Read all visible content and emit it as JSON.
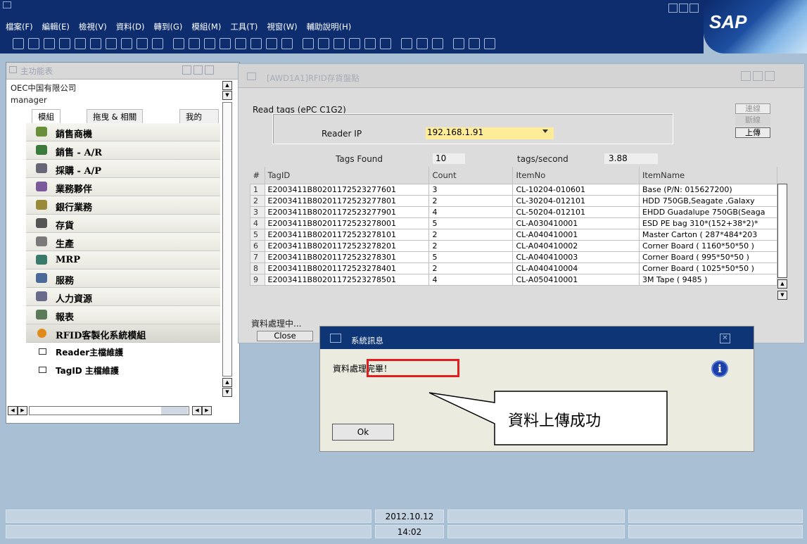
{
  "menu": [
    "檔案(F)",
    "編輯(E)",
    "檢視(V)",
    "資料(D)",
    "轉到(G)",
    "模組(M)",
    "工具(T)",
    "視窗(W)",
    "輔助說明(H)"
  ],
  "logo": "SAP",
  "main_menu": {
    "title": "主功能表",
    "company": "OEC中国有限公司",
    "user": "manager",
    "tabs": [
      "模組",
      "拖曳 & 相關",
      "我的"
    ],
    "modules": [
      {
        "label": "銷售商機",
        "icon": "opportunity-icon",
        "color": "#6a8f3a"
      },
      {
        "label": "銷售 - A/R",
        "icon": "sales-icon",
        "color": "#3c7a3c"
      },
      {
        "label": "採購 - A/P",
        "icon": "purchasing-icon",
        "color": "#667"
      },
      {
        "label": "業務夥伴",
        "icon": "partners-icon",
        "color": "#7a5a9a"
      },
      {
        "label": "銀行業務",
        "icon": "banking-icon",
        "color": "#998a3a"
      },
      {
        "label": "存貨",
        "icon": "inventory-icon",
        "color": "#555"
      },
      {
        "label": "生產",
        "icon": "production-icon",
        "color": "#7a7a7a"
      },
      {
        "label": "MRP",
        "icon": "mrp-icon",
        "color": "#3a7a6a"
      },
      {
        "label": "服務",
        "icon": "service-icon",
        "color": "#4a6a9a"
      },
      {
        "label": "人力資源",
        "icon": "hr-icon",
        "color": "#6a6a8a"
      },
      {
        "label": "報表",
        "icon": "reports-icon",
        "color": "#5a7a5a"
      },
      {
        "label": "RFID客製化系統模組",
        "icon": "rfid-icon",
        "color": "#e08a1a"
      }
    ],
    "submodules": [
      {
        "label": "Reader主檔維護"
      },
      {
        "label": "TagID 主檔維護"
      }
    ]
  },
  "rfid_window": {
    "title": "[AWD1A1]RFID存貨盤點",
    "read_tags": "Read tags (ePC C1G2)",
    "reader_ip_label": "Reader IP",
    "reader_ip": "192.168.1.91",
    "connect": "連線",
    "disconnect": "斷線",
    "upload": "上傳",
    "tags_found_label": "Tags Found",
    "tags_found": "10",
    "tags_per_second_label": "tags/second",
    "tags_per_second": "3.88",
    "columns": [
      "#",
      "TagID",
      "Count",
      "ItemNo",
      "ItemName"
    ],
    "rows": [
      [
        "1",
        "E2003411B80201172523277601",
        "3",
        "CL-10204-010601",
        "Base (P/N: 015627200)"
      ],
      [
        "2",
        "E2003411B80201172523277801",
        "2",
        "CL-30204-012101",
        "HDD 750GB,Seagate ,Galaxy"
      ],
      [
        "3",
        "E2003411B80201172523277901",
        "4",
        "CL-50204-012101",
        "EHDD Guadalupe 750GB(Seaga"
      ],
      [
        "4",
        "E2003411B80201172523278001",
        "5",
        "CL-A030410001",
        "ESD PE bag 310*(152+38*2)*"
      ],
      [
        "5",
        "E2003411B80201172523278101",
        "2",
        "CL-A040410001",
        "Master Carton ( 287*484*203"
      ],
      [
        "6",
        "E2003411B80201172523278201",
        "2",
        "CL-A040410002",
        "Corner Board ( 1160*50*50 )"
      ],
      [
        "7",
        "E2003411B80201172523278301",
        "5",
        "CL-A040410003",
        "Corner Board ( 995*50*50 )"
      ],
      [
        "8",
        "E2003411B80201172523278401",
        "2",
        "CL-A040410004",
        "Corner Board ( 1025*50*50 )"
      ],
      [
        "9",
        "E2003411B80201172523278501",
        "4",
        "CL-A050410001",
        "3M Tape ( 9485 )"
      ]
    ],
    "status": "資料處理中...",
    "close": "Close"
  },
  "message_dialog": {
    "title": "系統訊息",
    "text": "資料處理完畢！",
    "ok": "Ok"
  },
  "callout": "資料上傳成功",
  "statusbar": {
    "date": "2012.10.12",
    "time": "14:02"
  }
}
